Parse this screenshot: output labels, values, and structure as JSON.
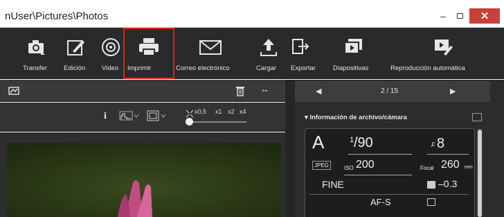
{
  "window": {
    "title": "nUser\\Pictures\\Photos",
    "minimize": "–",
    "close": "✕"
  },
  "toolbar": {
    "items": [
      {
        "label": "Transfer",
        "icon": "camera-transfer-icon"
      },
      {
        "label": "Edición",
        "icon": "edit-icon"
      },
      {
        "label": "Video",
        "icon": "video-icon"
      },
      {
        "label": "Imprimir",
        "icon": "printer-icon",
        "selected": true
      },
      {
        "label": "Correo electrónico",
        "icon": "mail-icon"
      },
      {
        "label": "Cargar",
        "icon": "upload-icon"
      },
      {
        "label": "Exportar",
        "icon": "export-icon"
      },
      {
        "label": "Diapositivas",
        "icon": "slideshow-icon"
      },
      {
        "label": "Reproducción automática",
        "icon": "autoplay-icon"
      }
    ],
    "highlight_color": "#e0211b"
  },
  "viewer_toolbar": {
    "rotate_label": "↔",
    "info_label": "i",
    "zoom_labels": [
      "x0,5",
      "x1",
      "x2",
      "x4"
    ]
  },
  "pager": {
    "prev": "◀",
    "next": "▶",
    "text": "2 / 15"
  },
  "info_panel": {
    "header": "Información de archivo/cámara",
    "mode": "A",
    "shutter_num": "1",
    "shutter_den": "/90",
    "aperture_prefix": "F",
    "aperture": "8",
    "format": "JPEG",
    "iso_prefix": "ISO",
    "iso": "200",
    "focal_prefix": "Focal",
    "focal": "260",
    "focal_unit": "mm",
    "quality": "FINE",
    "exposure_comp": "–0.3",
    "focus_mode": "AF-S"
  }
}
